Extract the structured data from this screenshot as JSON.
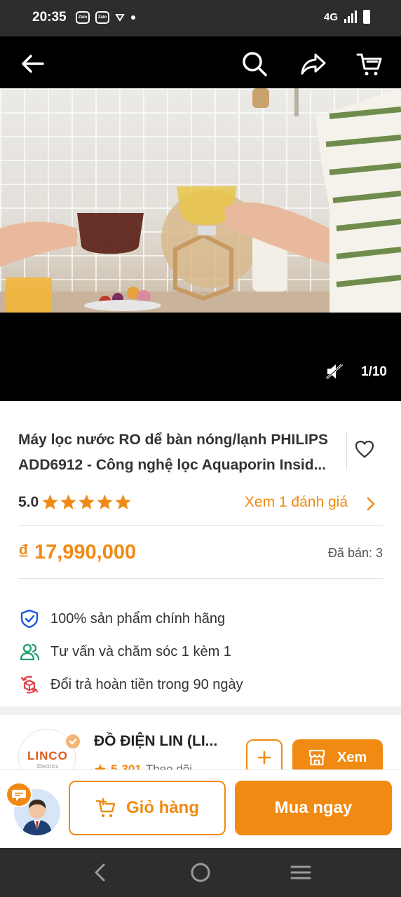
{
  "status_bar": {
    "time": "20:35",
    "zalo_1": "Zalo",
    "zalo_2": "Zalo",
    "network": "4G"
  },
  "header": {
    "icons": [
      "back-arrow-icon",
      "search-icon",
      "share-icon",
      "cart-icon"
    ]
  },
  "media": {
    "counter": "1/10",
    "mute_icon": "muted-speaker-icon"
  },
  "product": {
    "title_line1": "Máy lọc nước RO dể bàn nóng/lạnh PHILIPS",
    "title_line2": "ADD6912 - Công nghệ lọc Aquaporin Insid...",
    "rating": "5.0",
    "stars": 5,
    "review_link": "Xem 1 đánh giá",
    "price": "₫ 17,990,000",
    "sold": "Đã bán: 3"
  },
  "perks": [
    {
      "icon": "shield-check-icon",
      "text": "100% sản phẩm chính hãng"
    },
    {
      "icon": "users-icon",
      "text": "Tư vấn và chăm sóc 1 kèm 1"
    },
    {
      "icon": "return-box-icon",
      "text": "Đổi trả hoàn tiền trong 90 ngày"
    }
  ],
  "shop": {
    "logo_text": "LINCO",
    "logo_sub": "Electrics",
    "name": "ĐỒ ĐIỆN LIN (LI...",
    "rating": "5",
    "followers": "301",
    "followers_label": "Theo dõi",
    "view_label": "Xem"
  },
  "actions": {
    "cart_label": "Giỏ hàng",
    "buy_label": "Mua ngay"
  },
  "colors": {
    "accent": "#f08a13",
    "shield": "#1a56db",
    "users": "#1e9e6a",
    "return": "#e0424a"
  }
}
